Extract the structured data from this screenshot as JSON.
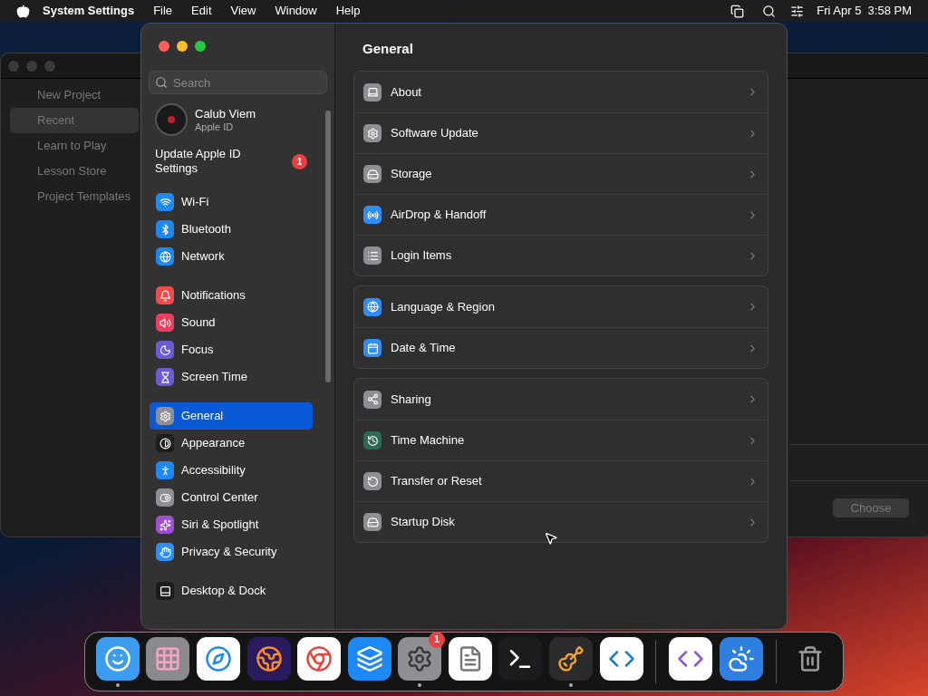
{
  "menu_bar": {
    "app": "System Settings",
    "menus": [
      "File",
      "Edit",
      "View",
      "Window",
      "Help"
    ],
    "clock": "Fri Apr 5  3:58 PM"
  },
  "background_window": {
    "items": [
      {
        "label": "New Project",
        "selected": false
      },
      {
        "label": "Recent",
        "selected": true
      },
      {
        "label": "Learn to Play",
        "selected": false
      },
      {
        "label": "Lesson Store",
        "selected": false
      },
      {
        "label": "Project Templates",
        "selected": false
      }
    ],
    "button": {
      "label": "Choose",
      "disabled": true
    }
  },
  "settings": {
    "search": {
      "placeholder": "Search"
    },
    "account": {
      "name": "Calub Viem",
      "subtitle": "Apple ID"
    },
    "notice": {
      "label": "Update Apple ID Settings",
      "badge": "1"
    },
    "sidebar": [
      [
        {
          "label": "Wi-Fi",
          "kind": "wifi",
          "color": "#1e88f5",
          "selected": false
        },
        {
          "label": "Bluetooth",
          "kind": "bluetooth",
          "color": "#1e88f5",
          "selected": false
        },
        {
          "label": "Network",
          "kind": "globe",
          "color": "#1e88f5",
          "selected": false
        }
      ],
      [
        {
          "label": "Notifications",
          "kind": "bell",
          "color": "#ef4b4b",
          "selected": false
        },
        {
          "label": "Sound",
          "kind": "sound",
          "color": "#ec3f5f",
          "selected": false
        },
        {
          "label": "Focus",
          "kind": "moon",
          "color": "#6b5bd6",
          "selected": false
        },
        {
          "label": "Screen Time",
          "kind": "hourglass",
          "color": "#6b5bd6",
          "selected": false
        }
      ],
      [
        {
          "label": "General",
          "kind": "gear",
          "color": "#8e8e93",
          "selected": true
        },
        {
          "label": "Appearance",
          "kind": "contrast",
          "color": "#1c1c1e",
          "selected": false
        },
        {
          "label": "Accessibility",
          "kind": "accessibility",
          "color": "#1e88f5",
          "selected": false
        },
        {
          "label": "Control Center",
          "kind": "toggle",
          "color": "#8e8e93",
          "selected": false
        },
        {
          "label": "Siri & Spotlight",
          "kind": "sparkles",
          "color": "#a04fd0",
          "selected": false
        },
        {
          "label": "Privacy & Security",
          "kind": "hand",
          "color": "#2f8ef5",
          "selected": false
        }
      ],
      [
        {
          "label": "Desktop & Dock",
          "kind": "dock",
          "color": "#1c1c1e",
          "selected": false
        }
      ]
    ],
    "title": "General",
    "groups": [
      [
        {
          "label": "About",
          "kind": "laptop",
          "color": "#8e8e93"
        },
        {
          "label": "Software Update",
          "kind": "gear",
          "color": "#8e8e93"
        },
        {
          "label": "Storage",
          "kind": "drive",
          "color": "#8e8e93"
        },
        {
          "label": "AirDrop & Handoff",
          "kind": "airdrop",
          "color": "#2f8ef5"
        },
        {
          "label": "Login Items",
          "kind": "list",
          "color": "#8e8e93"
        }
      ],
      [
        {
          "label": "Language & Region",
          "kind": "globe",
          "color": "#2f8ef5"
        },
        {
          "label": "Date & Time",
          "kind": "calendar",
          "color": "#2f8ef5"
        }
      ],
      [
        {
          "label": "Sharing",
          "kind": "share",
          "color": "#8e8e93"
        },
        {
          "label": "Time Machine",
          "kind": "history",
          "color": "#2e6b55"
        },
        {
          "label": "Transfer or Reset",
          "kind": "reset",
          "color": "#8e8e93"
        },
        {
          "label": "Startup Disk",
          "kind": "drive",
          "color": "#8e8e93"
        }
      ]
    ]
  },
  "dock": [
    [
      {
        "kind": "finder",
        "running": true
      },
      {
        "kind": "launchpad",
        "running": false
      },
      {
        "kind": "safari",
        "running": false
      },
      {
        "kind": "firefox",
        "running": false
      },
      {
        "kind": "chrome",
        "running": false
      },
      {
        "kind": "appstore",
        "running": false
      },
      {
        "kind": "settings",
        "running": true,
        "badge": "1"
      },
      {
        "kind": "textedit",
        "running": false
      },
      {
        "kind": "terminal",
        "running": false
      },
      {
        "kind": "guitar",
        "running": true
      },
      {
        "kind": "code",
        "running": false
      }
    ],
    [
      {
        "kind": "studio",
        "running": false
      },
      {
        "kind": "weather",
        "running": false
      }
    ],
    [
      {
        "kind": "trash",
        "running": false
      }
    ]
  ]
}
